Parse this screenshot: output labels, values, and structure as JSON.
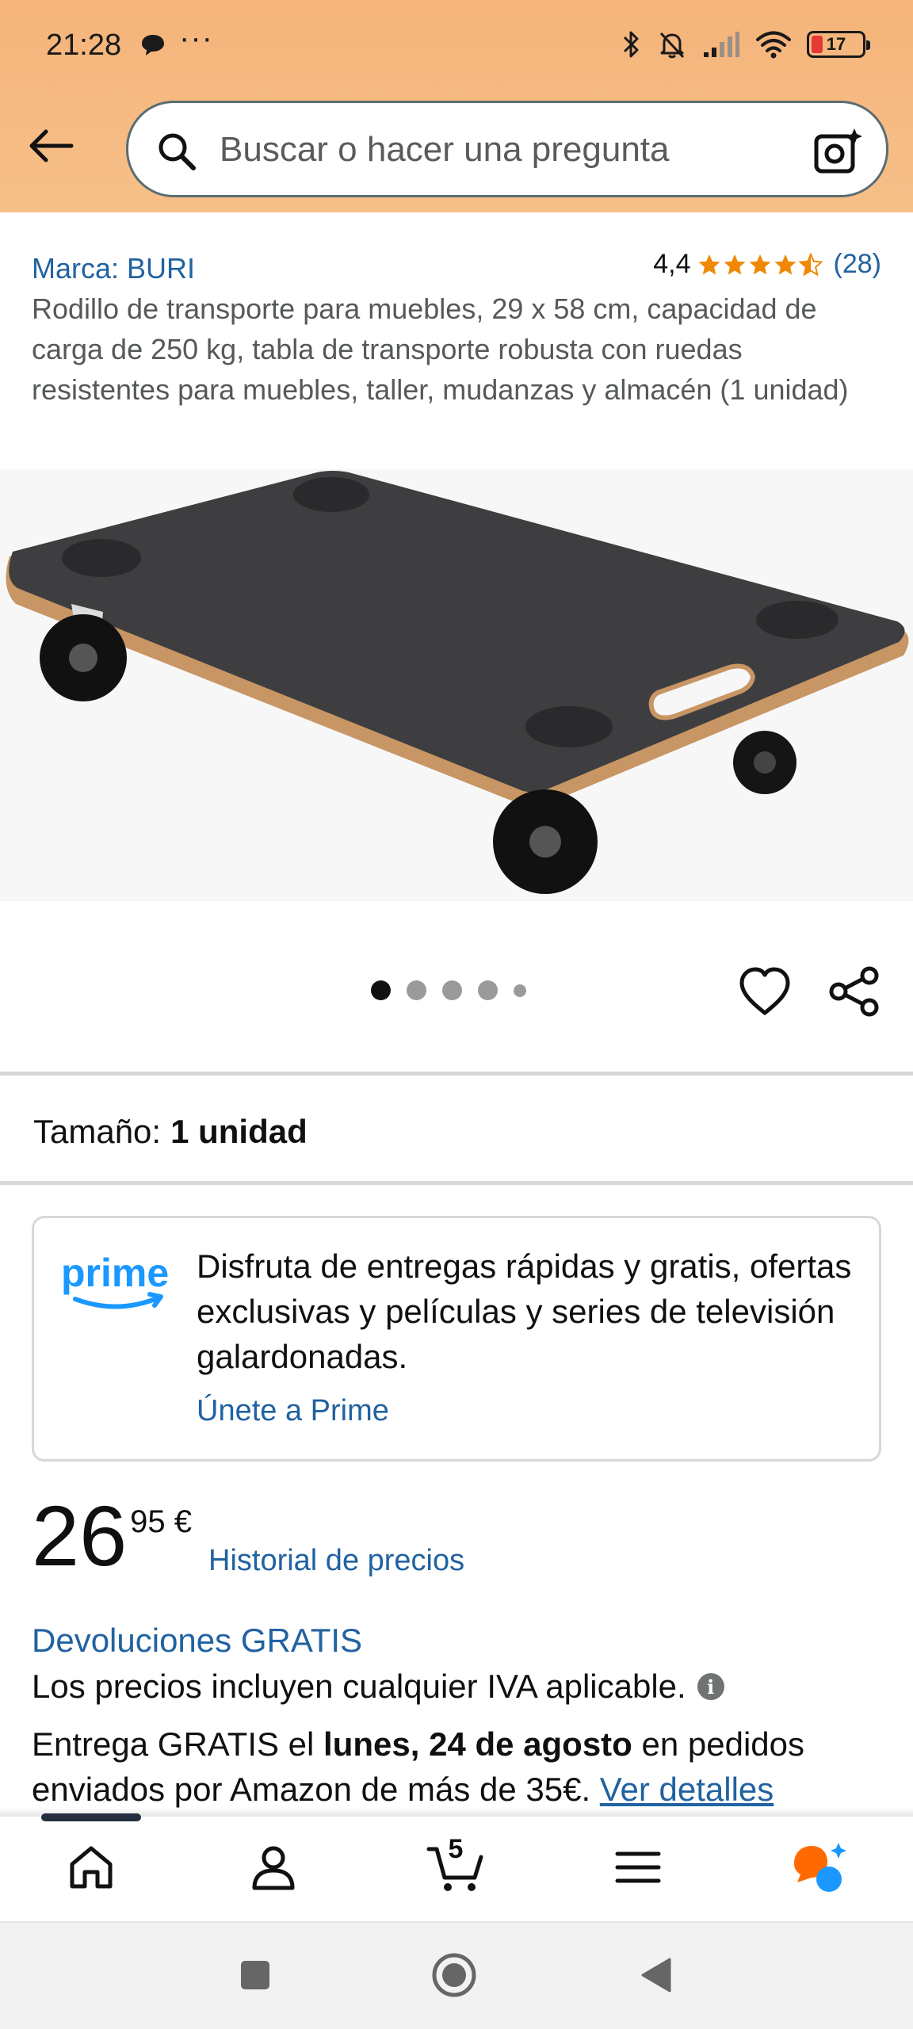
{
  "status_bar": {
    "time": "21:28",
    "dots": "···",
    "battery": "17"
  },
  "search": {
    "placeholder": "Buscar o hacer una pregunta"
  },
  "product": {
    "brand": "Marca: BURI",
    "rating": "4,4",
    "rating_value": 4.4,
    "review_count": "(28)",
    "title": "Rodillo de transporte para muebles, 29 x 58 cm, capacidad de carga de 250 kg, tabla de transporte robusta con ruedas resistentes para muebles, taller, mudanzas y almacén (1 unidad)",
    "image_count": 5,
    "active_image": 1
  },
  "size": {
    "label": "Tamaño:",
    "value": "1 unidad"
  },
  "prime": {
    "logo": "prime",
    "text": "Disfruta de entregas rápidas y gratis, ofertas exclusivas y películas y series de televisión galardonadas.",
    "link": "Únete a Prime"
  },
  "price": {
    "whole": "26",
    "fraction": "95 €",
    "history_link": "Historial de precios"
  },
  "returns": "Devoluciones GRATIS",
  "vat": "Los precios incluyen cualquier IVA aplicable.",
  "delivery": {
    "prefix": "Entrega GRATIS el",
    "date": "lunes, 24 de agosto",
    "suffix": "en pedidos enviados por Amazon de más de 35€.",
    "link": "Ver detalles"
  },
  "bottom_nav": {
    "cart_count": "5",
    "items": [
      "home-icon",
      "account-icon",
      "cart-icon",
      "menu-icon",
      "rufus-icon"
    ]
  },
  "colors": {
    "header_bg": "#f6b97e",
    "link": "#2162a1",
    "star": "#f08804",
    "prime_blue": "#1a98ff"
  }
}
